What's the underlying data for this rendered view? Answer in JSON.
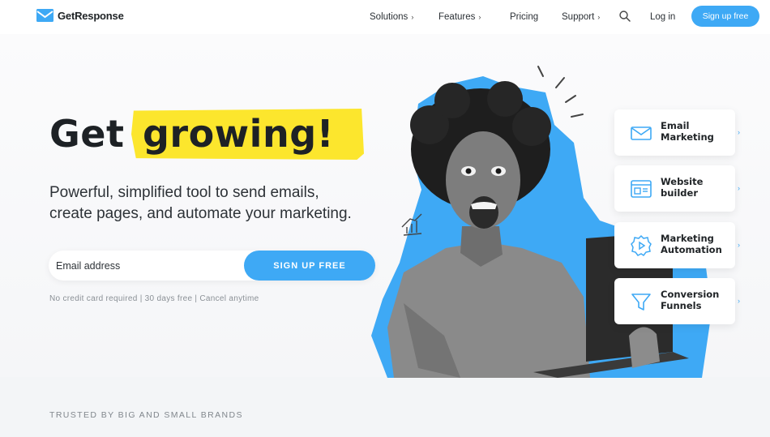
{
  "brand": {
    "name": "GetResponse",
    "accent": "#3ea9f5",
    "highlight": "#fce62d"
  },
  "nav": {
    "items": [
      {
        "label": "Solutions",
        "has_chevron": true
      },
      {
        "label": "Features",
        "has_chevron": true
      },
      {
        "label": "Pricing",
        "has_chevron": false
      },
      {
        "label": "Support",
        "has_chevron": true
      }
    ],
    "search_icon": "search-icon",
    "login_label": "Log in",
    "signup_label": "Sign up free"
  },
  "hero": {
    "headline_part1": "Get",
    "headline_part2": "growing!",
    "subline_1": "Powerful, simplified tool to send emails,",
    "subline_2": "create pages, and automate your marketing.",
    "email_placeholder": "Email address",
    "signup_button": "SIGN UP FREE",
    "fineprint": "No credit card required | 30 days free | Cancel anytime"
  },
  "features": [
    {
      "label": "Email\nMarketing",
      "icon": "envelope-icon"
    },
    {
      "label": "Website\nbuilder",
      "icon": "browser-window-icon"
    },
    {
      "label": "Marketing\nAutomation",
      "icon": "gear-play-icon"
    },
    {
      "label": "Conversion\nFunnels",
      "icon": "funnel-icon"
    }
  ],
  "trusted": {
    "label": "TRUSTED BY BIG AND SMALL BRANDS"
  }
}
